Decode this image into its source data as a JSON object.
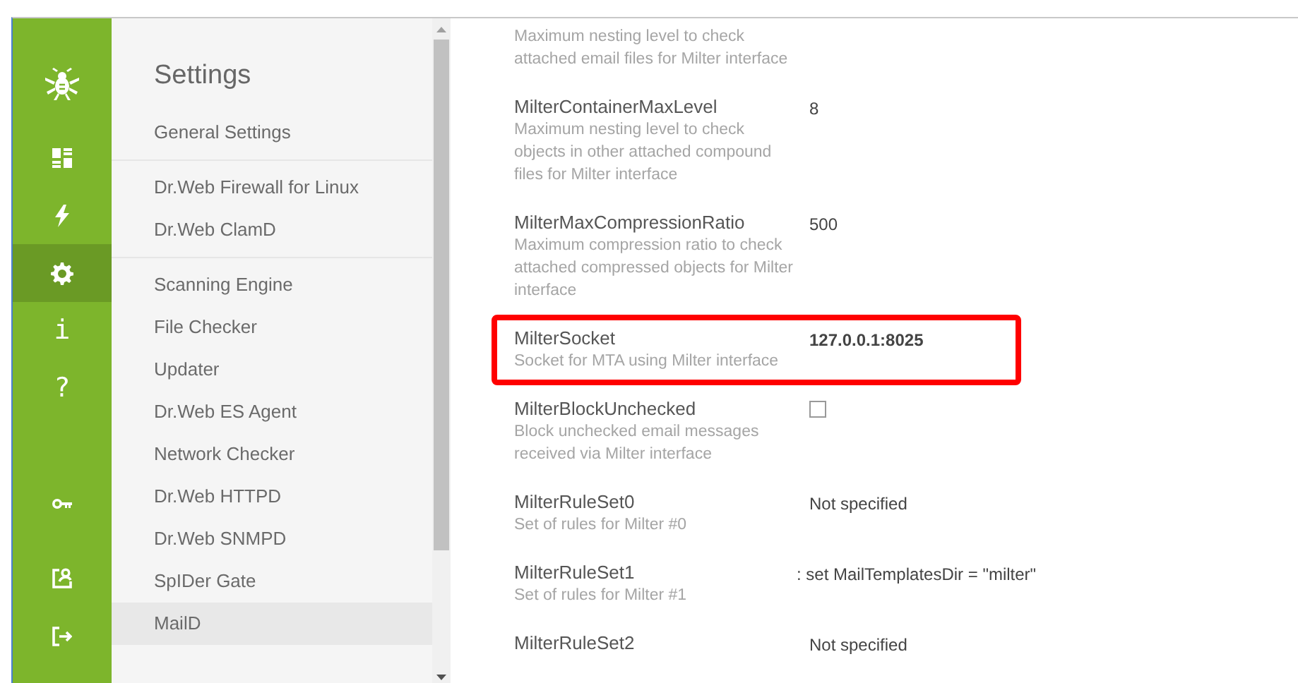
{
  "rail": [
    {
      "kind": "logo",
      "selected": false
    },
    {
      "kind": "dashboard",
      "selected": false
    },
    {
      "kind": "bolt",
      "selected": false
    },
    {
      "kind": "gear",
      "selected": true
    },
    {
      "kind": "char",
      "char": "i",
      "selected": false
    },
    {
      "kind": "char",
      "char": "?",
      "selected": false
    },
    {
      "kind": "key",
      "selected": false
    },
    {
      "kind": "user",
      "selected": false
    },
    {
      "kind": "logout",
      "selected": false
    }
  ],
  "sidebar": {
    "title": "Settings",
    "groups": [
      [
        {
          "label": "General Settings",
          "selected": false
        }
      ],
      [
        {
          "label": "Dr.Web Firewall for Linux",
          "selected": false
        },
        {
          "label": "Dr.Web ClamD",
          "selected": false
        }
      ],
      [
        {
          "label": "Scanning Engine",
          "selected": false
        },
        {
          "label": "File Checker",
          "selected": false
        },
        {
          "label": "Updater",
          "selected": false
        },
        {
          "label": "Dr.Web ES Agent",
          "selected": false
        },
        {
          "label": "Network Checker",
          "selected": false
        },
        {
          "label": "Dr.Web HTTPD",
          "selected": false
        },
        {
          "label": "Dr.Web SNMPD",
          "selected": false
        },
        {
          "label": "SpIDer Gate",
          "selected": false
        },
        {
          "label": "MailD",
          "selected": true
        }
      ]
    ]
  },
  "settings": [
    {
      "kind": "text",
      "description": "Maximum nesting level to check attached email files for Milter interface",
      "highlighted": false
    },
    {
      "kind": "text",
      "name": "MilterContainerMaxLevel",
      "description": "Maximum nesting level to check objects in other attached compound files for Milter interface",
      "value": "8",
      "highlighted": false
    },
    {
      "kind": "text",
      "name": "MilterMaxCompressionRatio",
      "description": "Maximum compression ratio to check attached compressed objects for Milter interface",
      "value": "500",
      "highlighted": false
    },
    {
      "kind": "text",
      "name": "MilterSocket",
      "description": "Socket for MTA using Milter interface",
      "value": "127.0.0.1:8025",
      "highlighted": true
    },
    {
      "kind": "checkbox",
      "name": "MilterBlockUnchecked",
      "description": "Block unchecked email messages received via Milter interface",
      "checked": false,
      "highlighted": false
    },
    {
      "kind": "text",
      "name": "MilterRuleSet0",
      "description": "Set of rules for Milter #0",
      "value": "Not specified",
      "highlighted": false
    },
    {
      "kind": "text",
      "name": "MilterRuleSet1",
      "description": "Set of rules for Milter #1",
      "value": ": set MailTemplatesDir = \"milter\"",
      "highlighted": false
    },
    {
      "kind": "text",
      "name": "MilterRuleSet2",
      "value": "Not specified",
      "highlighted": false
    }
  ]
}
